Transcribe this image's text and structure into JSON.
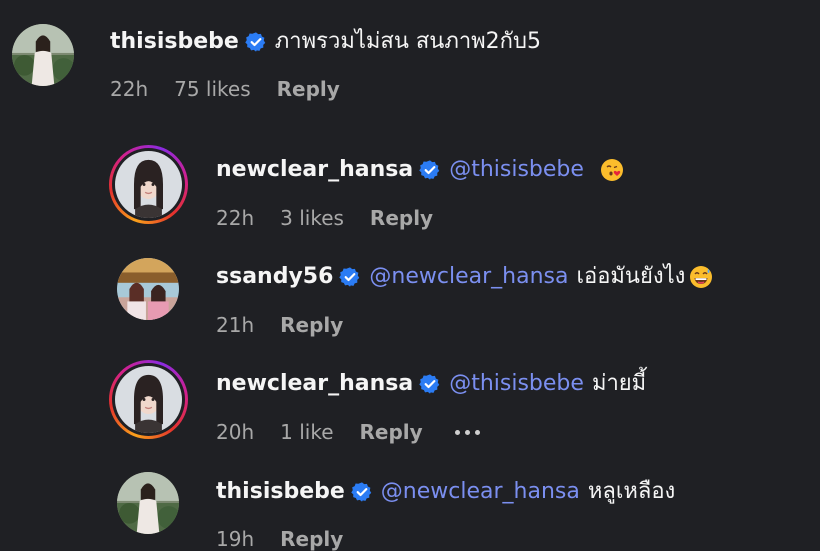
{
  "colors": {
    "background": "#1f2024",
    "text": "#f5f5f5",
    "meta": "#a8a8a8",
    "mention": "#7b8ff0",
    "verified_badge": "#2b7cf4"
  },
  "comments": [
    {
      "username": "thisisbebe",
      "verified": true,
      "mention": "",
      "text": "ภาพรวมไม่สน สนภาพ2กับ5",
      "emoji": "",
      "time": "22h",
      "likes": "75 likes",
      "reply": "Reply",
      "avatar": "photo-avatar-bebe"
    },
    {
      "username": "newclear_hansa",
      "verified": true,
      "mention": "@thisisbebe",
      "text": "",
      "emoji": "face-blowing-kiss-emoji",
      "time": "22h",
      "likes": "3 likes",
      "reply": "Reply",
      "avatar": "story-ring-avatar-hansa"
    },
    {
      "username": "ssandy56",
      "verified": true,
      "mention": "@newclear_hansa",
      "text": "เอ่อมันยังไง",
      "emoji": "grinning-sweat-emoji",
      "time": "21h",
      "likes": "",
      "reply": "Reply",
      "avatar": "photo-avatar-sandy"
    },
    {
      "username": "newclear_hansa",
      "verified": true,
      "mention": "@thisisbebe",
      "text": "ม่ายมี้",
      "emoji": "",
      "time": "20h",
      "likes": "1 like",
      "reply": "Reply",
      "more": "more-options-icon",
      "avatar": "story-ring-avatar-hansa"
    },
    {
      "username": "thisisbebe",
      "verified": true,
      "mention": "@newclear_hansa",
      "text": "หลูเหลือง",
      "emoji": "",
      "time": "19h",
      "likes": "",
      "reply": "Reply",
      "avatar": "photo-avatar-bebe"
    }
  ]
}
